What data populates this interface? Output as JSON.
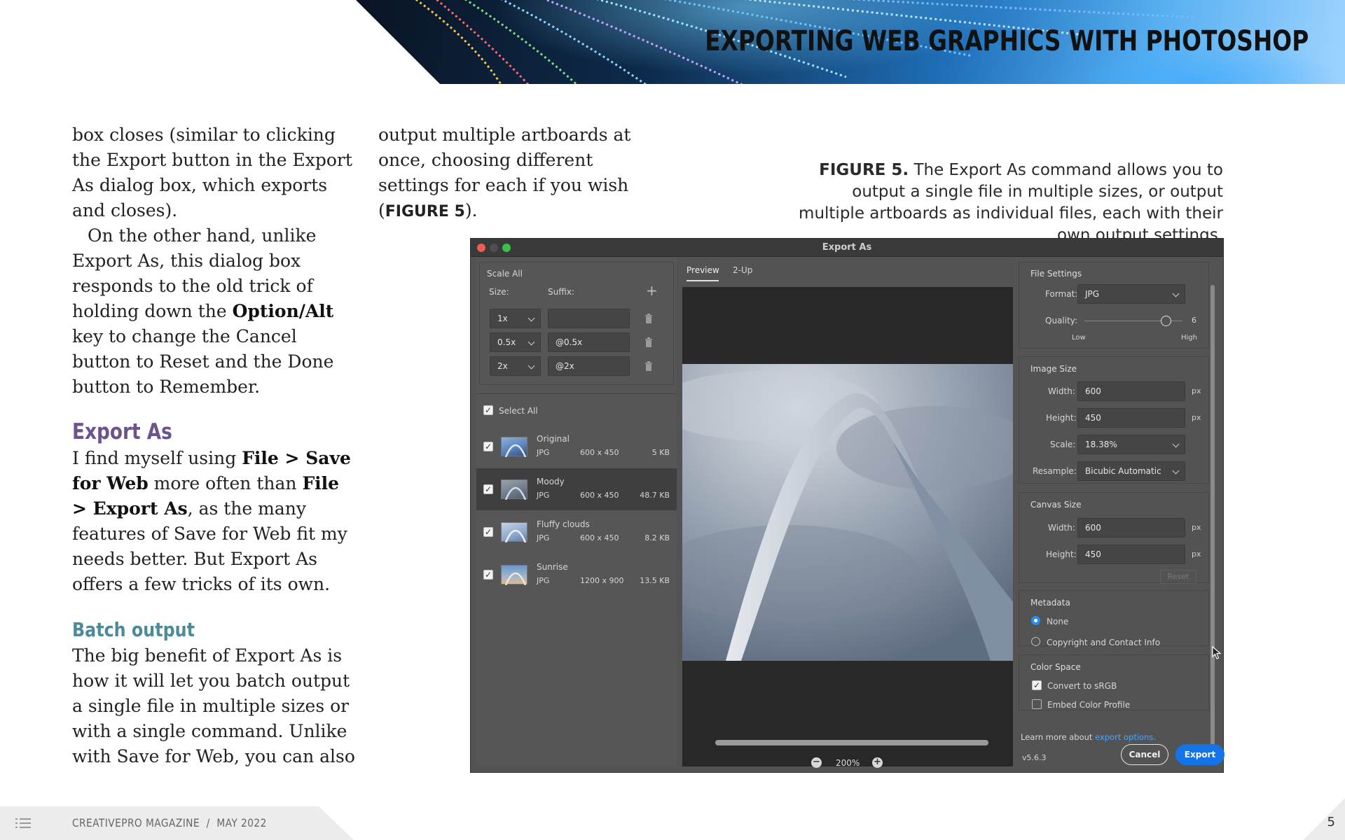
{
  "header": {
    "title": "EXPORTING WEB GRAPHICS WITH PHOTOSHOP"
  },
  "column1": {
    "p1": "box closes (similar to clicking the Export button in the Export As dialog box, which exports and closes).",
    "p2_a": "On the other hand, unlike Export As, this dialog box responds to the old trick of holding down the ",
    "p2_b": "Option/Alt",
    "p2_c": " key to change the Cancel button to Reset and the Done button to Remember.",
    "heading1": "Export As",
    "p3_a": "I find myself using ",
    "p3_b": "File > Save for Web",
    "p3_c": " more often than ",
    "p3_d": "File > Export As",
    "p3_e": ", as the many features of Save for Web fit my needs better. But Export As offers a few tricks of its own.",
    "heading2": "Batch output",
    "p4": "The big benefit of Export As is how it will let you batch output a single file in multiple sizes or with a single command. Unlike with Save for Web, you can also"
  },
  "column2": {
    "p1_a": "output multiple artboards at once, choosing different settings for each if you wish (",
    "p1_ref": "FIGURE 5",
    "p1_b": ")."
  },
  "caption": {
    "label": "FIGURE 5.",
    "text": " The Export As command allows you to output a single file in multiple sizes, or output multiple artboards as individual files, each with their own output settings."
  },
  "dialog": {
    "title": "Export As",
    "scale_all": {
      "title": "Scale All",
      "size_label": "Size:",
      "suffix_label": "Suffix:",
      "add_glyph": "+",
      "rows": [
        {
          "size": "1x",
          "suffix": ""
        },
        {
          "size": "0.5x",
          "suffix": "@0.5x"
        },
        {
          "size": "2x",
          "suffix": "@2x"
        }
      ]
    },
    "select_all": "Select All",
    "files": [
      {
        "name": "Original",
        "format": "JPG",
        "dims": "600 x 450",
        "size": "5 KB"
      },
      {
        "name": "Moody",
        "format": "JPG",
        "dims": "600 x 450",
        "size": "48.7 KB"
      },
      {
        "name": "Fluffy clouds",
        "format": "JPG",
        "dims": "600 x 450",
        "size": "8.2 KB"
      },
      {
        "name": "Sunrise",
        "format": "JPG",
        "dims": "1200 x 900",
        "size": "13.5 KB"
      }
    ],
    "tabs": [
      "Preview",
      "2-Up"
    ],
    "zoom": "200%",
    "file_settings": {
      "title": "File Settings",
      "format_label": "Format:",
      "format": "JPG",
      "quality_label": "Quality:",
      "quality": "6",
      "quality_fraction": 0.83,
      "low": "Low",
      "high": "High"
    },
    "image_size": {
      "title": "Image Size",
      "width_label": "Width:",
      "width": "600",
      "height_label": "Height:",
      "height": "450",
      "scale_label": "Scale:",
      "scale": "18.38%",
      "resample_label": "Resample:",
      "resample": "Bicubic Automatic",
      "unit": "px"
    },
    "canvas_size": {
      "title": "Canvas Size",
      "width_label": "Width:",
      "width": "600",
      "height_label": "Height:",
      "height": "450",
      "unit": "px",
      "reset": "Reset"
    },
    "metadata": {
      "title": "Metadata",
      "options": [
        "None",
        "Copyright and Contact Info"
      ]
    },
    "color_space": {
      "title": "Color Space",
      "convert": "Convert to sRGB",
      "embed": "Embed Color Profile"
    },
    "learn_more": "Learn more about ",
    "learn_link": "export options.",
    "version": "v5.6.3",
    "cancel": "Cancel",
    "export": "Export"
  },
  "footer": {
    "magazine": "CREATIVEPRO MAGAZINE  /  MAY 2022",
    "page": "5"
  },
  "colors": {
    "heading_purple": "#6d5290",
    "heading_teal": "#4c8a9a",
    "export_blue": "#1473e6"
  }
}
